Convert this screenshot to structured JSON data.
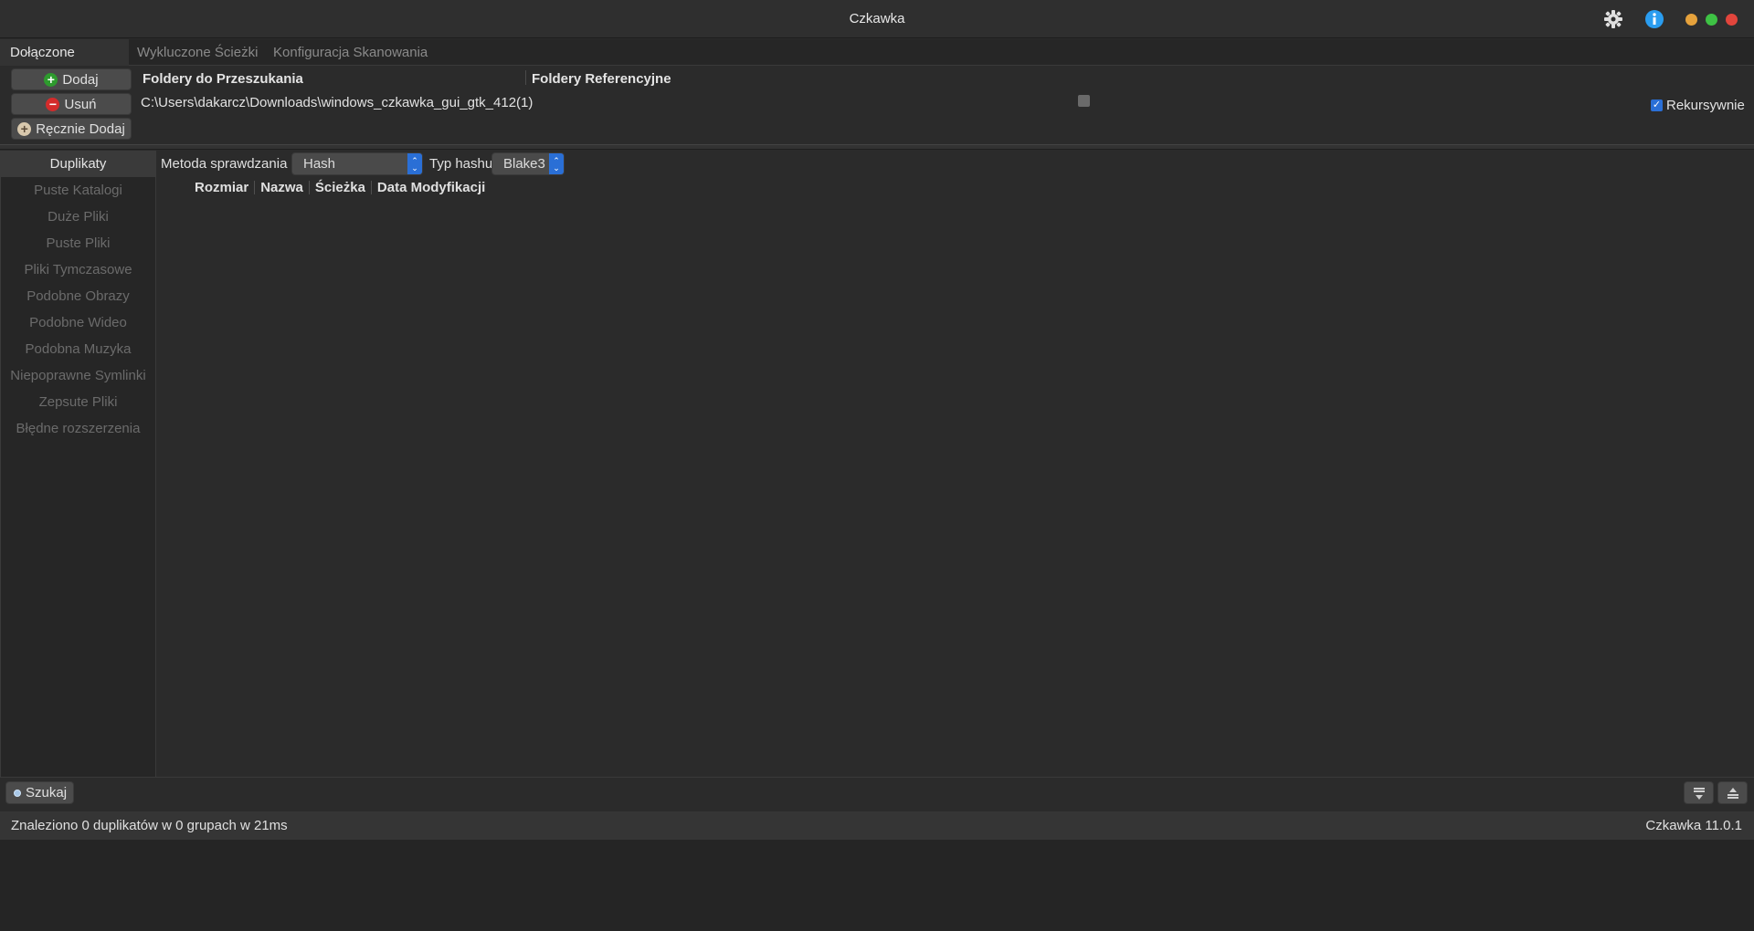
{
  "window": {
    "title": "Czkawka"
  },
  "tabs": [
    {
      "label": "Dołączone ścieżki"
    },
    {
      "label": "Wykluczone Ścieżki"
    },
    {
      "label": "Konfiguracja Skanowania"
    }
  ],
  "paths_panel": {
    "add_label": "Dodaj",
    "remove_label": "Usuń",
    "manual_add_label": "Ręcznie Dodaj",
    "col_search": "Foldery do Przeszukania",
    "col_reference": "Foldery Referencyjne",
    "rows": [
      {
        "path": "C:\\Users\\dakarcz\\Downloads\\windows_czkawka_gui_gtk_412(1)"
      }
    ],
    "recursive_label": "Rekursywnie"
  },
  "sidebar": {
    "items": [
      {
        "label": "Duplikaty"
      },
      {
        "label": "Puste Katalogi"
      },
      {
        "label": "Duże Pliki"
      },
      {
        "label": "Puste Pliki"
      },
      {
        "label": "Pliki Tymczasowe"
      },
      {
        "label": "Podobne Obrazy"
      },
      {
        "label": "Podobne Wideo"
      },
      {
        "label": "Podobna Muzyka"
      },
      {
        "label": "Niepoprawne Symlinki"
      },
      {
        "label": "Zepsute Pliki"
      },
      {
        "label": "Błędne rozszerzenia"
      }
    ]
  },
  "options": {
    "method_label": "Metoda sprawdzania",
    "method_value": "Hash",
    "hash_type_label": "Typ hashu",
    "hash_type_value": "Blake3"
  },
  "table": {
    "columns": [
      "Rozmiar",
      "Nazwa",
      "Ścieżka",
      "Data Modyfikacji"
    ]
  },
  "bottom": {
    "search_label": "Szukaj"
  },
  "status": {
    "message": "Znaleziono 0 duplikatów w 0 grupach w 21ms",
    "version": "Czkawka 11.0.1"
  },
  "colors": {
    "accent": "#2a6fd6",
    "background": "#2b2b2b"
  }
}
